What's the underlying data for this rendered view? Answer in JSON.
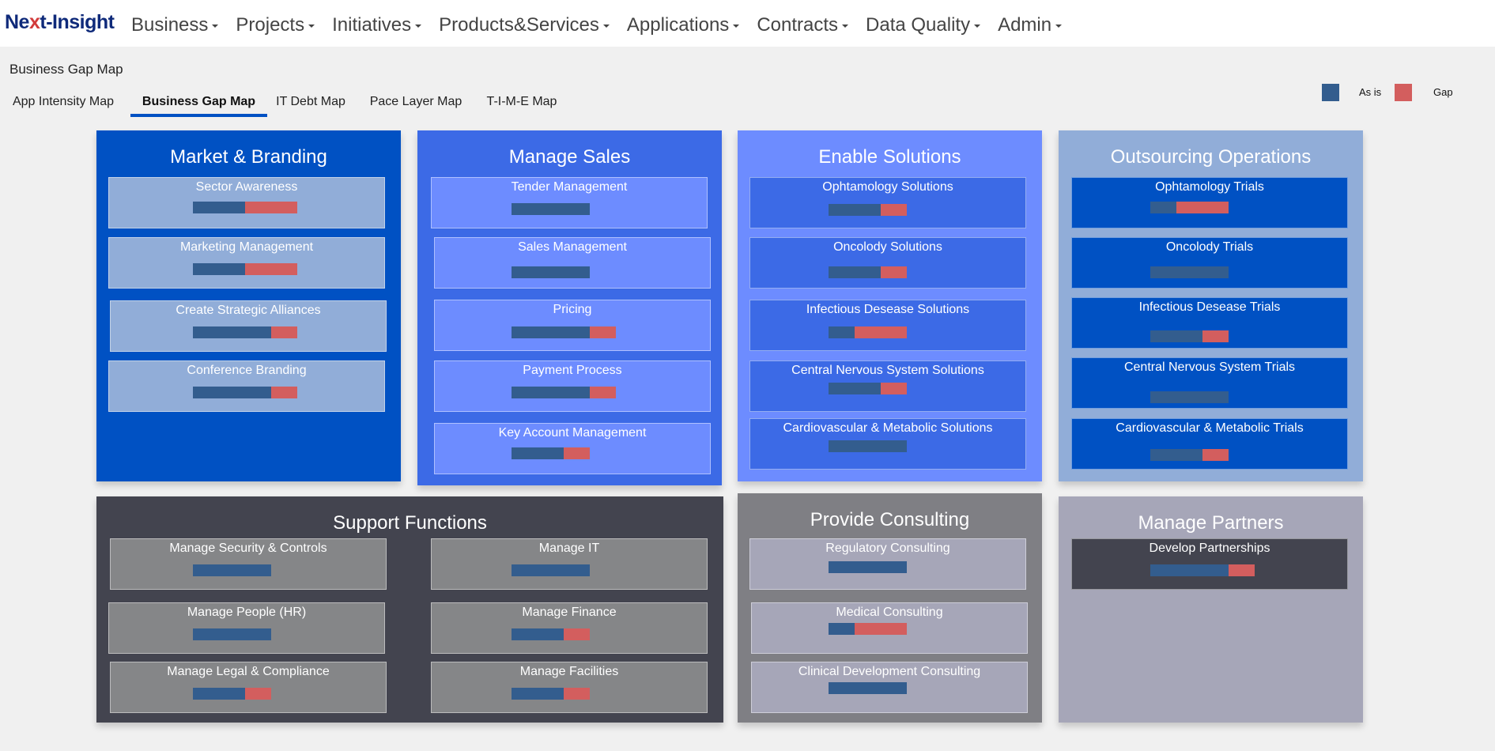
{
  "nav": {
    "logo": {
      "part1": "Ne",
      "part2": "x",
      "part3": "t-Insight"
    },
    "items": [
      "Business",
      "Projects",
      "Initiatives",
      "Products&Services",
      "Applications",
      "Contracts",
      "Data Quality",
      "Admin"
    ]
  },
  "page": {
    "title": "Business Gap Map",
    "tabs": [
      "App Intensity Map",
      "Business Gap Map",
      "IT Debt Map",
      "Pace Layer Map",
      "T-I-M-E Map"
    ],
    "active_tab": "Business Gap Map"
  },
  "legend": {
    "asis_label": "As is",
    "asis_color": "#335d8e",
    "gap_label": "Gap",
    "gap_color": "#d35e5e"
  },
  "groups": {
    "market": {
      "title": "Market & Branding",
      "caps": [
        {
          "label": "Sector Awareness",
          "asis": 4,
          "gap": 4
        },
        {
          "label": "Marketing Management",
          "asis": 4,
          "gap": 4
        },
        {
          "label": "Create Strategic Alliances",
          "asis": 6,
          "gap": 2
        },
        {
          "label": "Conference Branding",
          "asis": 6,
          "gap": 2
        }
      ]
    },
    "sales": {
      "title": "Manage Sales",
      "caps": [
        {
          "label": "Tender Management",
          "asis": 6,
          "gap": 0
        },
        {
          "label": "Sales Management",
          "asis": 6,
          "gap": 0
        },
        {
          "label": "Pricing",
          "asis": 6,
          "gap": 2
        },
        {
          "label": "Payment Process",
          "asis": 6,
          "gap": 2
        },
        {
          "label": "Key Account Management",
          "asis": 4,
          "gap": 2
        }
      ]
    },
    "solutions": {
      "title": "Enable Solutions",
      "caps": [
        {
          "label": "Ophtamology Solutions",
          "asis": 4,
          "gap": 2
        },
        {
          "label": "Oncolody Solutions",
          "asis": 4,
          "gap": 2
        },
        {
          "label": "Infectious Desease Solutions",
          "asis": 2,
          "gap": 4
        },
        {
          "label": "Central Nervous System Solutions",
          "asis": 4,
          "gap": 2
        },
        {
          "label": "Cardiovascular & Metabolic Solutions",
          "asis": 6,
          "gap": 0
        }
      ]
    },
    "outsourcing": {
      "title": "Outsourcing Operations",
      "caps": [
        {
          "label": "Ophtamology Trials",
          "asis": 2,
          "gap": 4
        },
        {
          "label": "Oncolody Trials",
          "asis": 6,
          "gap": 0
        },
        {
          "label": "Infectious Desease Trials",
          "asis": 4,
          "gap": 2
        },
        {
          "label": "Central Nervous System Trials",
          "asis": 6,
          "gap": 0
        },
        {
          "label": "Cardiovascular & Metabolic Trials",
          "asis": 4,
          "gap": 2
        }
      ]
    },
    "support": {
      "title": "Support Functions",
      "caps": [
        {
          "label": "Manage Security & Controls",
          "asis": 6,
          "gap": 0
        },
        {
          "label": "Manage IT",
          "asis": 6,
          "gap": 0
        },
        {
          "label": "Manage People (HR)",
          "asis": 6,
          "gap": 0
        },
        {
          "label": "Manage Finance",
          "asis": 4,
          "gap": 2
        },
        {
          "label": "Manage Legal & Compliance",
          "asis": 4,
          "gap": 2
        },
        {
          "label": "Manage Facilities",
          "asis": 4,
          "gap": 2
        }
      ]
    },
    "consulting": {
      "title": "Provide Consulting",
      "caps": [
        {
          "label": "Regulatory Consulting",
          "asis": 6,
          "gap": 0
        },
        {
          "label": "Medical Consulting",
          "asis": 2,
          "gap": 4
        },
        {
          "label": "Clinical Development Consulting",
          "asis": 6,
          "gap": 0
        }
      ]
    },
    "partners": {
      "title": "Manage Partners",
      "caps": [
        {
          "label": "Develop Partnerships",
          "asis": 6,
          "gap": 2
        }
      ]
    }
  }
}
